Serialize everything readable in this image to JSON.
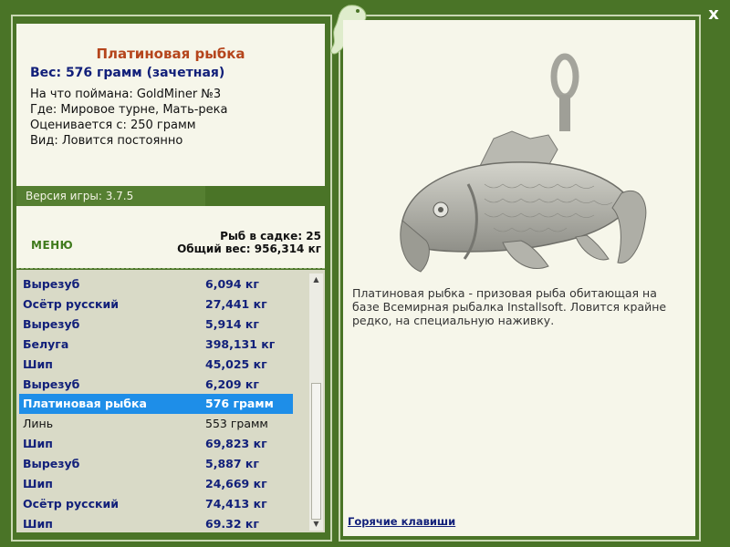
{
  "window": {
    "close_label": "x"
  },
  "fish_info": {
    "title": "Платиновая рыбка",
    "weight_line": "Вес: 576 грамм (зачетная)",
    "lines": [
      "На что поймана: GoldMiner №3",
      "Где: Мировое турне, Мать-река",
      "Оценивается с: 250 грамм",
      "Вид: Ловится постоянно"
    ]
  },
  "version": "Версия игры: 3.7.5",
  "menu_label": "МЕНЮ",
  "catch_count": "Рыб в садке: 25",
  "catch_weight": "Общий вес: 956,314 кг",
  "catch_list": [
    {
      "name": "Вырезуб",
      "weight": "6,094 кг",
      "style": "bold"
    },
    {
      "name": "Осётр русский",
      "weight": "27,441 кг",
      "style": "bold"
    },
    {
      "name": "Вырезуб",
      "weight": "5,914 кг",
      "style": "bold"
    },
    {
      "name": "Белуга",
      "weight": "398,131 кг",
      "style": "bold"
    },
    {
      "name": "Шип",
      "weight": "45,025 кг",
      "style": "bold"
    },
    {
      "name": "Вырезуб",
      "weight": "6,209 кг",
      "style": "bold"
    },
    {
      "name": "Платиновая рыбка",
      "weight": "576 грамм",
      "style": "selected"
    },
    {
      "name": "Линь",
      "weight": "553 грамм",
      "style": "plain"
    },
    {
      "name": "Шип",
      "weight": "69,823 кг",
      "style": "bold"
    },
    {
      "name": "Вырезуб",
      "weight": "5,887 кг",
      "style": "bold"
    },
    {
      "name": "Шип",
      "weight": "24,669 кг",
      "style": "bold"
    },
    {
      "name": "Осётр русский",
      "weight": "74,413 кг",
      "style": "bold"
    },
    {
      "name": "Шип",
      "weight": "69.32 кг",
      "style": "bold"
    }
  ],
  "description": "Платиновая рыбка - призовая рыба обитающая на базе Всемирная рыбалка Installsoft. Ловится крайне редко, на специальную наживку.",
  "hotkeys_label": "Горячие клавиши",
  "colors": {
    "frame": "#4a7427",
    "panel": "#f6f6ea",
    "list_bg": "#d9dac7",
    "selected": "#1e8ee8",
    "title": "#b5451c",
    "bold_text": "#12207a"
  }
}
